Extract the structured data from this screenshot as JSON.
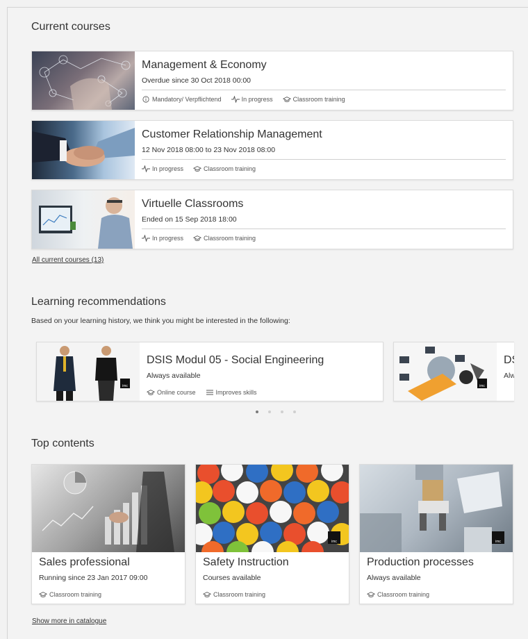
{
  "current_courses": {
    "title": "Current courses",
    "items": [
      {
        "title": "Management & Economy",
        "subtitle": "Overdue since 30 Oct 2018 00:00",
        "meta": [
          {
            "icon": "info-icon",
            "label": "Mandatory/ Verpflichtend"
          },
          {
            "icon": "activity-icon",
            "label": "In progress"
          },
          {
            "icon": "graduation-cap-icon",
            "label": "Classroom training"
          }
        ]
      },
      {
        "title": "Customer Relationship Management",
        "subtitle": "12 Nov 2018 08:00 to 23 Nov 2018 08:00",
        "meta": [
          {
            "icon": "activity-icon",
            "label": "In progress"
          },
          {
            "icon": "graduation-cap-icon",
            "label": "Classroom training"
          }
        ]
      },
      {
        "title": "Virtuelle Classrooms",
        "subtitle": "Ended on 15 Sep 2018 18:00",
        "meta": [
          {
            "icon": "activity-icon",
            "label": "In progress"
          },
          {
            "icon": "graduation-cap-icon",
            "label": "Classroom training"
          }
        ]
      }
    ],
    "all_link": "All current courses (13)"
  },
  "recommendations": {
    "title": "Learning recommendations",
    "description": "Based on your learning history, we think you might be interested in the following:",
    "items": [
      {
        "title": "DSIS Modul 05 - Social Engineering",
        "subtitle": "Always available",
        "meta": [
          {
            "icon": "graduation-cap-icon",
            "label": "Online course"
          },
          {
            "icon": "list-icon",
            "label": "Improves skills"
          }
        ],
        "badge": "imc"
      },
      {
        "title_partial": "DS",
        "subtitle_partial": "Alw",
        "badge": "imc"
      }
    ],
    "pagination": {
      "count": 4,
      "active": 0
    }
  },
  "top_contents": {
    "title": "Top contents",
    "items": [
      {
        "title": "Sales professional",
        "subtitle": "Running since 23 Jan 2017 09:00",
        "meta": "Classroom training"
      },
      {
        "title": "Safety Instruction",
        "subtitle": "Courses available",
        "meta": "Classroom training",
        "badge": "imc"
      },
      {
        "title": "Production processes",
        "subtitle": "Always available",
        "meta": "Classroom training",
        "badge": "imc"
      }
    ],
    "more_link": "Show more in catalogue"
  }
}
